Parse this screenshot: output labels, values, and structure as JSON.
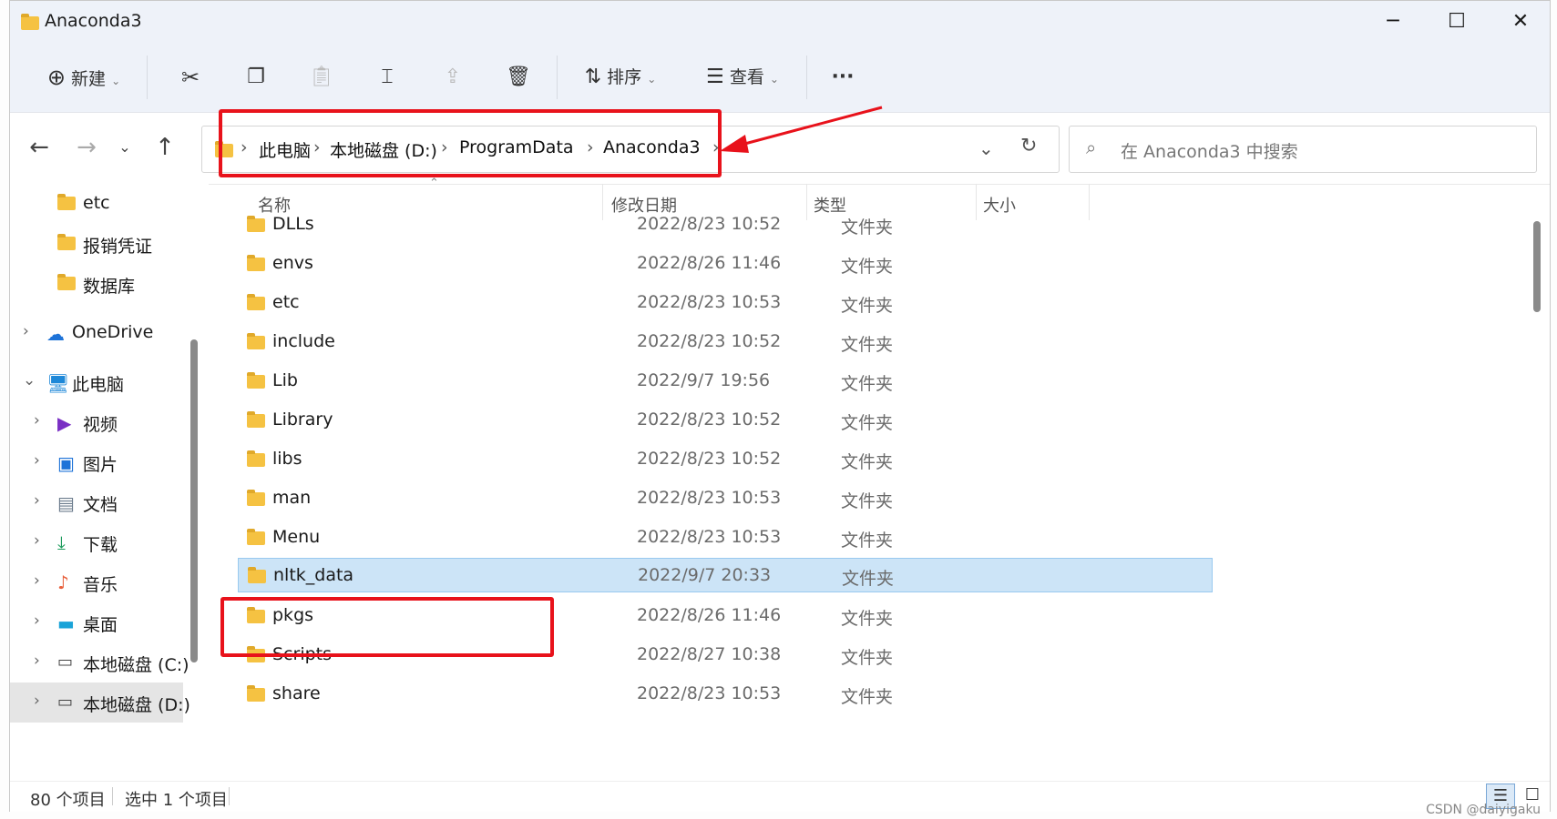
{
  "window": {
    "title": "Anaconda3"
  },
  "toolbar": {
    "new_label": "新建",
    "sort_label": "排序",
    "view_label": "查看",
    "more_label": "···"
  },
  "address": {
    "crumbs": [
      "此电脑",
      "本地磁盘 (D:)",
      "ProgramData",
      "Anaconda3"
    ]
  },
  "search": {
    "placeholder": "在 Anaconda3 中搜索"
  },
  "sidebar": {
    "items": [
      {
        "label": "etc",
        "icon": "folder-icon"
      },
      {
        "label": "报销凭证",
        "icon": "folder-icon"
      },
      {
        "label": "数据库",
        "icon": "folder-icon"
      },
      {
        "label": "OneDrive",
        "icon": "cloud-icon"
      },
      {
        "label": "此电脑",
        "icon": "computer-icon"
      },
      {
        "label": "视频",
        "icon": "video-icon"
      },
      {
        "label": "图片",
        "icon": "picture-icon"
      },
      {
        "label": "文档",
        "icon": "document-icon"
      },
      {
        "label": "下载",
        "icon": "download-icon"
      },
      {
        "label": "音乐",
        "icon": "music-icon"
      },
      {
        "label": "桌面",
        "icon": "desktop-icon"
      },
      {
        "label": "本地磁盘 (C:)",
        "icon": "drive-icon"
      },
      {
        "label": "本地磁盘 (D:)",
        "icon": "drive-icon"
      }
    ]
  },
  "columns": {
    "name": "名称",
    "modified": "修改日期",
    "type": "类型",
    "size": "大小"
  },
  "files": [
    {
      "name": "DLLs",
      "date": "2022/8/23 10:52",
      "type": "文件夹"
    },
    {
      "name": "envs",
      "date": "2022/8/26 11:46",
      "type": "文件夹"
    },
    {
      "name": "etc",
      "date": "2022/8/23 10:53",
      "type": "文件夹"
    },
    {
      "name": "include",
      "date": "2022/8/23 10:52",
      "type": "文件夹"
    },
    {
      "name": "Lib",
      "date": "2022/9/7 19:56",
      "type": "文件夹"
    },
    {
      "name": "Library",
      "date": "2022/8/23 10:52",
      "type": "文件夹"
    },
    {
      "name": "libs",
      "date": "2022/8/23 10:52",
      "type": "文件夹"
    },
    {
      "name": "man",
      "date": "2022/8/23 10:53",
      "type": "文件夹"
    },
    {
      "name": "Menu",
      "date": "2022/8/23 10:53",
      "type": "文件夹"
    },
    {
      "name": "nltk_data",
      "date": "2022/9/7 20:33",
      "type": "文件夹"
    },
    {
      "name": "pkgs",
      "date": "2022/8/26 11:46",
      "type": "文件夹"
    },
    {
      "name": "Scripts",
      "date": "2022/8/27 10:38",
      "type": "文件夹"
    },
    {
      "name": "share",
      "date": "2022/8/23 10:53",
      "type": "文件夹"
    }
  ],
  "status": {
    "count": "80 个项目",
    "selected": "选中 1 个项目"
  },
  "watermark": "CSDN @daiyigaku",
  "colors": {
    "accent_red": "#e8121b",
    "selection": "#cce4f7",
    "folder": "#f5c242"
  }
}
